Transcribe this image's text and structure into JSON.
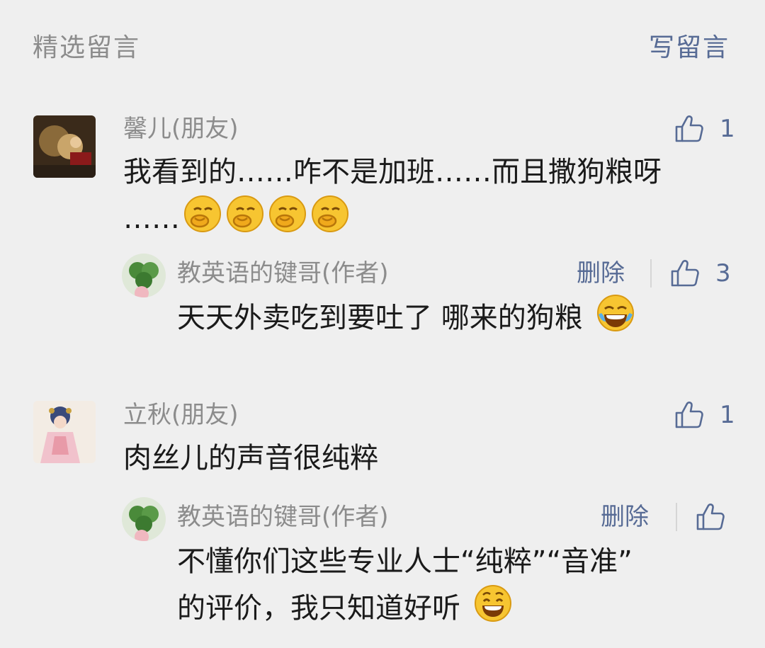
{
  "header": {
    "section_title": "精选留言",
    "write_label": "写留言"
  },
  "comments": [
    {
      "nickname": "馨儿(朋友)",
      "like_count": "1",
      "text_line1": "我看到的……咋不是加班……而且撒狗粮呀",
      "text_line2": "……",
      "text_emojis": [
        "hush-emoji",
        "hush-emoji",
        "hush-emoji",
        "hush-emoji"
      ],
      "reply": {
        "nickname": "教英语的键哥(作者)",
        "delete_label": "删除",
        "like_count": "3",
        "text": "天天外卖吃到要吐了 哪来的狗粮",
        "emoji": "tears-of-joy-emoji"
      }
    },
    {
      "nickname": "立秋(朋友)",
      "like_count": "1",
      "text_line1": "肉丝儿的声音很纯粹",
      "reply": {
        "nickname": "教英语的键哥(作者)",
        "delete_label": "删除",
        "like_count": "",
        "text_line1": "不懂你们这些专业人士“纯粹”“音准”",
        "text_line2": "的评价，我只知道好听",
        "emoji": "grin-emoji"
      }
    }
  ],
  "colors": {
    "background": "#efefef",
    "link": "#576b95",
    "meta_text": "#8c8c8c",
    "body_text": "#1a1a1a"
  }
}
